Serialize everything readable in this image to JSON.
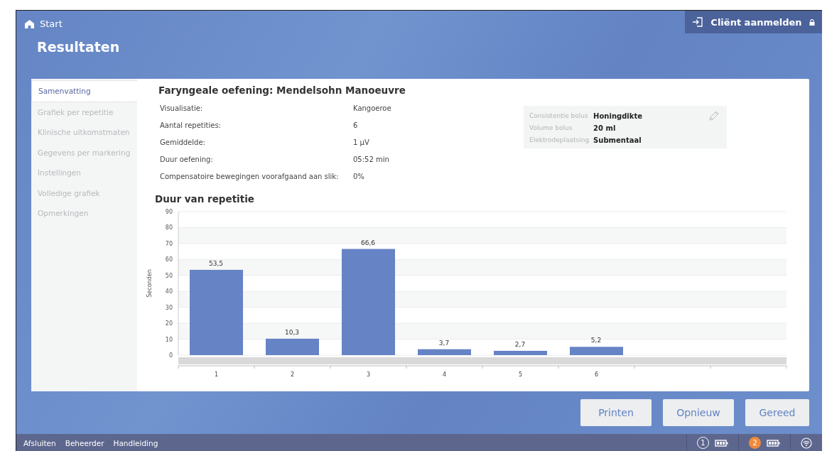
{
  "header": {
    "home": "Start",
    "title": "Resultaten",
    "login_button": "Cliënt aanmelden"
  },
  "sidebar": {
    "items": [
      {
        "label": "Samenvatting",
        "selected": true
      },
      {
        "label": "Grafiek per repetitie",
        "selected": false
      },
      {
        "label": "Klinische uitkomstmaten",
        "selected": false
      },
      {
        "label": "Gegevens per markering",
        "selected": false
      },
      {
        "label": "Instellingen",
        "selected": false
      },
      {
        "label": "Volledige grafiek",
        "selected": false
      },
      {
        "label": "Opmerkingen",
        "selected": false
      }
    ]
  },
  "exercise": {
    "title": "Faryngeale oefening: Mendelsohn Manoeuvre",
    "rows": [
      {
        "label": "Visualisatie:",
        "value": "Kangoeroe"
      },
      {
        "label": "Aantal repetities:",
        "value": "6"
      },
      {
        "label": "Gemiddelde:",
        "value": "1 µV"
      },
      {
        "label": "Duur oefening:",
        "value": "05:52 min"
      },
      {
        "label": "Compensatoire bewegingen voorafgaand aan slik:",
        "value": "0%"
      }
    ],
    "bolus": [
      {
        "label": "Consistentie bolus",
        "value": "Honingdikte"
      },
      {
        "label": "Volume bolus",
        "value": "20 ml"
      },
      {
        "label": "Elektrodeplaatsing",
        "value": "Submentaal"
      }
    ]
  },
  "chart": {
    "heading": "Duur van repetitie",
    "chart_data": {
      "type": "bar",
      "ylabel": "Seconden",
      "categories": [
        "1",
        "2",
        "3",
        "4",
        "5",
        "6"
      ],
      "grid": true,
      "series": [
        {
          "color": "#6683c5",
          "values": [
            53.5,
            10.3,
            66.6,
            3.7,
            2.7,
            5.2
          ]
        }
      ],
      "value_labels": [
        "53,5",
        "10,3",
        "66,6",
        "3,7",
        "2,7",
        "5,2"
      ],
      "ylim": [
        0,
        90
      ],
      "yticks": [
        0,
        10,
        20,
        30,
        40,
        50,
        60,
        70,
        80,
        90
      ]
    }
  },
  "actions": [
    "Printen",
    "Opnieuw",
    "Gereed"
  ],
  "status_bar": {
    "links": [
      "Afsluiten",
      "Beheerder",
      "Handleiding"
    ],
    "devices": [
      {
        "label": "1",
        "selected": false
      },
      {
        "label": "2",
        "selected": true
      }
    ]
  }
}
